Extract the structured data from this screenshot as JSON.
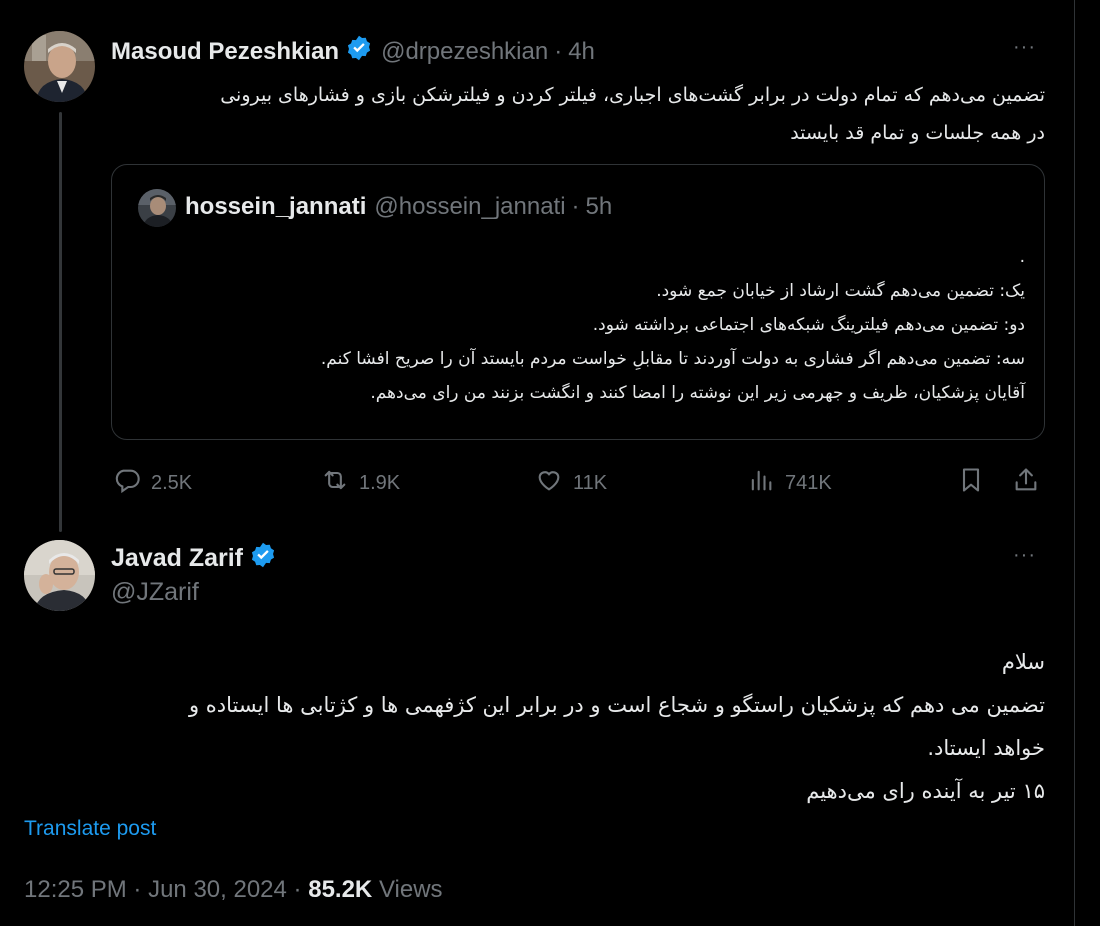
{
  "tweet1": {
    "author": {
      "name": "Masoud Pezeshkian",
      "handle": "@drpezeshkian",
      "time": "4h"
    },
    "dot": "·",
    "more": "···",
    "lines": [
      "تضمین می‌دهم که تمام دولت در برابر  گشت‌های اجباری، فیلتر کردن و فیلترشکن بازی و فشارهای بیرونی",
      "در همه جلسات و تمام قد بایستد"
    ],
    "quote": {
      "author": {
        "name": "hossein_jannati",
        "handle": "@hossein_jannati",
        "time": "5h"
      },
      "dot": "·",
      "lines": [
        ".",
        "یک: تضمین می‌دهم گشت ارشاد از خیابان جمع شود.",
        "دو: تضمین می‌دهم فیلترینگ شبکه‌های اجتماعی برداشته شود.",
        "سه: تضمین می‌دهم اگر فشاری به دولت آوردند تا مقابلِ خواست مردم بایستد آن را صریح افشا کنم.",
        "آقایان پزشکیان، ظریف و جهرمی زیر این نوشته را امضا کنند و انگشت بزنند من رای می‌دهم."
      ]
    },
    "actions": {
      "replies": "2.5K",
      "reposts": "1.9K",
      "likes": "11K",
      "views": "741K"
    }
  },
  "tweet2": {
    "author": {
      "name": "Javad Zarif",
      "handle": "@JZarif"
    },
    "more": "···",
    "lines": [
      "سلام",
      "تضمین می دهم که پزشکیان راستگو و شجاع است و  در برابر این کژفهمی ها و کژتابی ها ایستاده و",
      "خواهد ایستاد.",
      "۱۵ تیر به آینده رای می‌دهیم"
    ],
    "translate": "Translate post",
    "meta": {
      "time": "12:25 PM",
      "date": "Jun 30, 2024",
      "views": "85.2K",
      "views_label": "Views",
      "dot": "·"
    }
  },
  "colors": {
    "accent": "#1d9bf0",
    "muted": "#71767b",
    "text": "#e7e9ea",
    "border": "#2f3336"
  }
}
